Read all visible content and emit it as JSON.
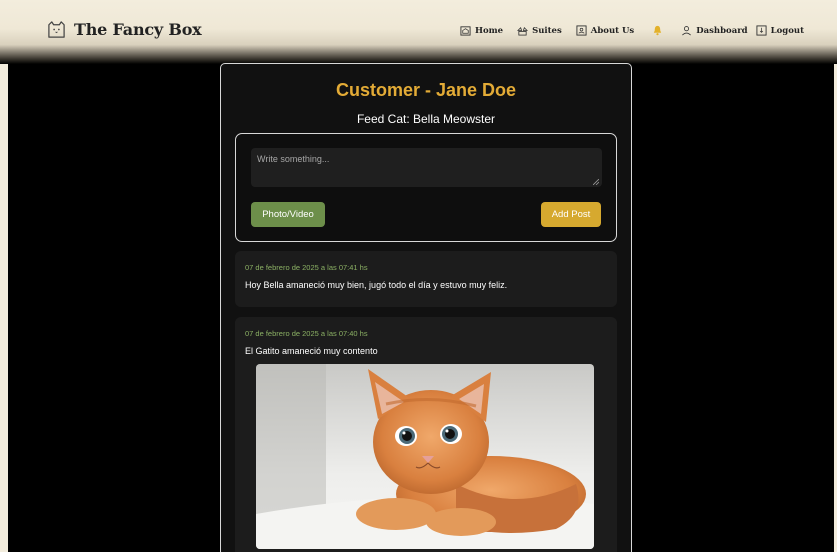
{
  "app": {
    "brand_name": "The Fancy Box",
    "brand_icon": "cat-box-icon"
  },
  "nav": {
    "home": "Home",
    "suites": "Suites",
    "about": "About Us",
    "dashboard": "Dashboard",
    "logout": "Logout",
    "icons": [
      "home-icon",
      "suites-icon",
      "about-icon",
      "bell-icon",
      "user-icon",
      "logout-icon"
    ]
  },
  "page": {
    "title": "Customer - Jane Doe",
    "subtitle": "Feed Cat: Bella Meowster"
  },
  "composer": {
    "placeholder": "Write something...",
    "photo_button": "Photo/Video",
    "post_button": "Add Post"
  },
  "posts": [
    {
      "date": "07 de febrero de 2025 a las 07:41 hs",
      "text": "Hoy Bella amaneció muy bien, jugó todo el día y estuvo muy feliz."
    },
    {
      "date": "07 de febrero de 2025 a las 07:40 hs",
      "text": "El Gatito amaneció muy contento",
      "image": "kitten-photo"
    }
  ],
  "colors": {
    "accent_gold": "#e3ab36",
    "photo_button": "#6d8f4a",
    "post_button": "#d6a92f",
    "date_green": "#8bb064",
    "navbar": "#f3eddd"
  }
}
